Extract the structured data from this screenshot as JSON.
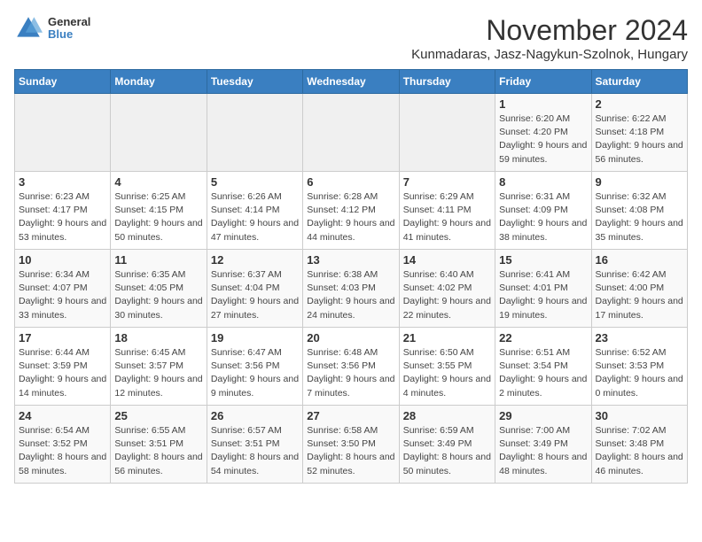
{
  "header": {
    "logo": {
      "general": "General",
      "blue": "Blue"
    },
    "title": "November 2024",
    "subtitle": "Kunmadaras, Jasz-Nagykun-Szolnok, Hungary"
  },
  "calendar": {
    "weekdays": [
      "Sunday",
      "Monday",
      "Tuesday",
      "Wednesday",
      "Thursday",
      "Friday",
      "Saturday"
    ],
    "weeks": [
      [
        {
          "day": "",
          "info": ""
        },
        {
          "day": "",
          "info": ""
        },
        {
          "day": "",
          "info": ""
        },
        {
          "day": "",
          "info": ""
        },
        {
          "day": "",
          "info": ""
        },
        {
          "day": "1",
          "info": "Sunrise: 6:20 AM\nSunset: 4:20 PM\nDaylight: 9 hours and 59 minutes."
        },
        {
          "day": "2",
          "info": "Sunrise: 6:22 AM\nSunset: 4:18 PM\nDaylight: 9 hours and 56 minutes."
        }
      ],
      [
        {
          "day": "3",
          "info": "Sunrise: 6:23 AM\nSunset: 4:17 PM\nDaylight: 9 hours and 53 minutes."
        },
        {
          "day": "4",
          "info": "Sunrise: 6:25 AM\nSunset: 4:15 PM\nDaylight: 9 hours and 50 minutes."
        },
        {
          "day": "5",
          "info": "Sunrise: 6:26 AM\nSunset: 4:14 PM\nDaylight: 9 hours and 47 minutes."
        },
        {
          "day": "6",
          "info": "Sunrise: 6:28 AM\nSunset: 4:12 PM\nDaylight: 9 hours and 44 minutes."
        },
        {
          "day": "7",
          "info": "Sunrise: 6:29 AM\nSunset: 4:11 PM\nDaylight: 9 hours and 41 minutes."
        },
        {
          "day": "8",
          "info": "Sunrise: 6:31 AM\nSunset: 4:09 PM\nDaylight: 9 hours and 38 minutes."
        },
        {
          "day": "9",
          "info": "Sunrise: 6:32 AM\nSunset: 4:08 PM\nDaylight: 9 hours and 35 minutes."
        }
      ],
      [
        {
          "day": "10",
          "info": "Sunrise: 6:34 AM\nSunset: 4:07 PM\nDaylight: 9 hours and 33 minutes."
        },
        {
          "day": "11",
          "info": "Sunrise: 6:35 AM\nSunset: 4:05 PM\nDaylight: 9 hours and 30 minutes."
        },
        {
          "day": "12",
          "info": "Sunrise: 6:37 AM\nSunset: 4:04 PM\nDaylight: 9 hours and 27 minutes."
        },
        {
          "day": "13",
          "info": "Sunrise: 6:38 AM\nSunset: 4:03 PM\nDaylight: 9 hours and 24 minutes."
        },
        {
          "day": "14",
          "info": "Sunrise: 6:40 AM\nSunset: 4:02 PM\nDaylight: 9 hours and 22 minutes."
        },
        {
          "day": "15",
          "info": "Sunrise: 6:41 AM\nSunset: 4:01 PM\nDaylight: 9 hours and 19 minutes."
        },
        {
          "day": "16",
          "info": "Sunrise: 6:42 AM\nSunset: 4:00 PM\nDaylight: 9 hours and 17 minutes."
        }
      ],
      [
        {
          "day": "17",
          "info": "Sunrise: 6:44 AM\nSunset: 3:59 PM\nDaylight: 9 hours and 14 minutes."
        },
        {
          "day": "18",
          "info": "Sunrise: 6:45 AM\nSunset: 3:57 PM\nDaylight: 9 hours and 12 minutes."
        },
        {
          "day": "19",
          "info": "Sunrise: 6:47 AM\nSunset: 3:56 PM\nDaylight: 9 hours and 9 minutes."
        },
        {
          "day": "20",
          "info": "Sunrise: 6:48 AM\nSunset: 3:56 PM\nDaylight: 9 hours and 7 minutes."
        },
        {
          "day": "21",
          "info": "Sunrise: 6:50 AM\nSunset: 3:55 PM\nDaylight: 9 hours and 4 minutes."
        },
        {
          "day": "22",
          "info": "Sunrise: 6:51 AM\nSunset: 3:54 PM\nDaylight: 9 hours and 2 minutes."
        },
        {
          "day": "23",
          "info": "Sunrise: 6:52 AM\nSunset: 3:53 PM\nDaylight: 9 hours and 0 minutes."
        }
      ],
      [
        {
          "day": "24",
          "info": "Sunrise: 6:54 AM\nSunset: 3:52 PM\nDaylight: 8 hours and 58 minutes."
        },
        {
          "day": "25",
          "info": "Sunrise: 6:55 AM\nSunset: 3:51 PM\nDaylight: 8 hours and 56 minutes."
        },
        {
          "day": "26",
          "info": "Sunrise: 6:57 AM\nSunset: 3:51 PM\nDaylight: 8 hours and 54 minutes."
        },
        {
          "day": "27",
          "info": "Sunrise: 6:58 AM\nSunset: 3:50 PM\nDaylight: 8 hours and 52 minutes."
        },
        {
          "day": "28",
          "info": "Sunrise: 6:59 AM\nSunset: 3:49 PM\nDaylight: 8 hours and 50 minutes."
        },
        {
          "day": "29",
          "info": "Sunrise: 7:00 AM\nSunset: 3:49 PM\nDaylight: 8 hours and 48 minutes."
        },
        {
          "day": "30",
          "info": "Sunrise: 7:02 AM\nSunset: 3:48 PM\nDaylight: 8 hours and 46 minutes."
        }
      ]
    ]
  }
}
